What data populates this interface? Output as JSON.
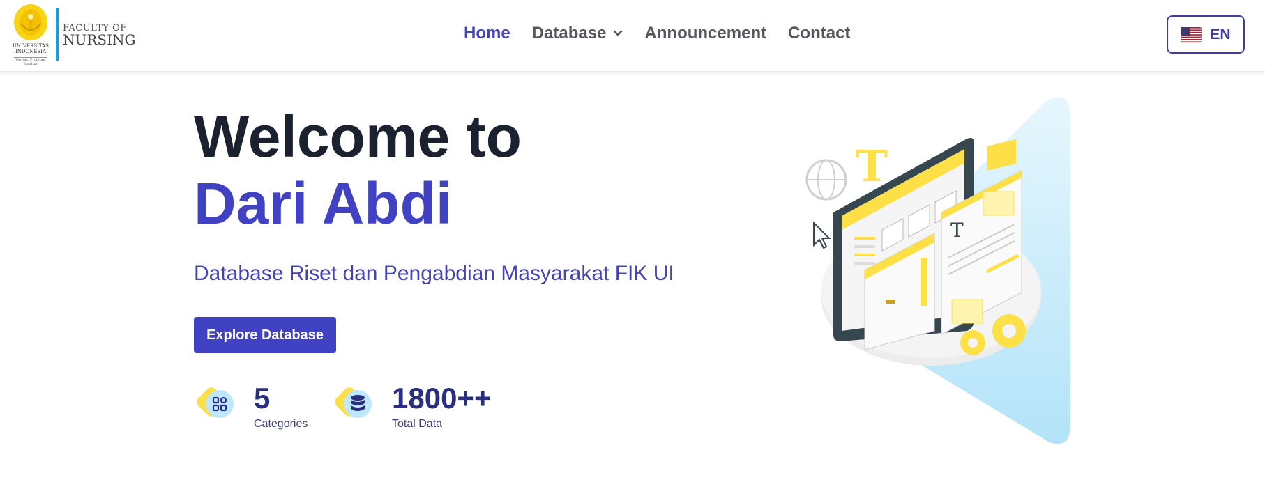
{
  "header": {
    "logo": {
      "university": "UNIVERSITAS INDONESIA",
      "motto": "Veritas, Probitas, Iustitia",
      "faculty_line1": "FACULTY OF",
      "faculty_line2": "NURSING"
    },
    "nav": [
      {
        "label": "Home",
        "active": true
      },
      {
        "label": "Database",
        "dropdown": true
      },
      {
        "label": "Announcement"
      },
      {
        "label": "Contact"
      }
    ],
    "language": {
      "label": "EN",
      "flag": "us-flag-icon"
    }
  },
  "hero": {
    "title_line1": "Welcome to",
    "title_line2": "Dari Abdi",
    "subtitle": "Database Riset dan Pengabdian Masyarakat FIK UI",
    "cta_label": "Explore Database",
    "stats": [
      {
        "value": "5",
        "label": "Categories",
        "icon": "categories-icon"
      },
      {
        "value": "1800++",
        "label": "Total Data",
        "icon": "database-icon"
      }
    ]
  },
  "colors": {
    "primary": "#4141c4",
    "heading": "#1c2130",
    "accent_yellow": "#fde047",
    "accent_blue": "#bfe7fb"
  }
}
